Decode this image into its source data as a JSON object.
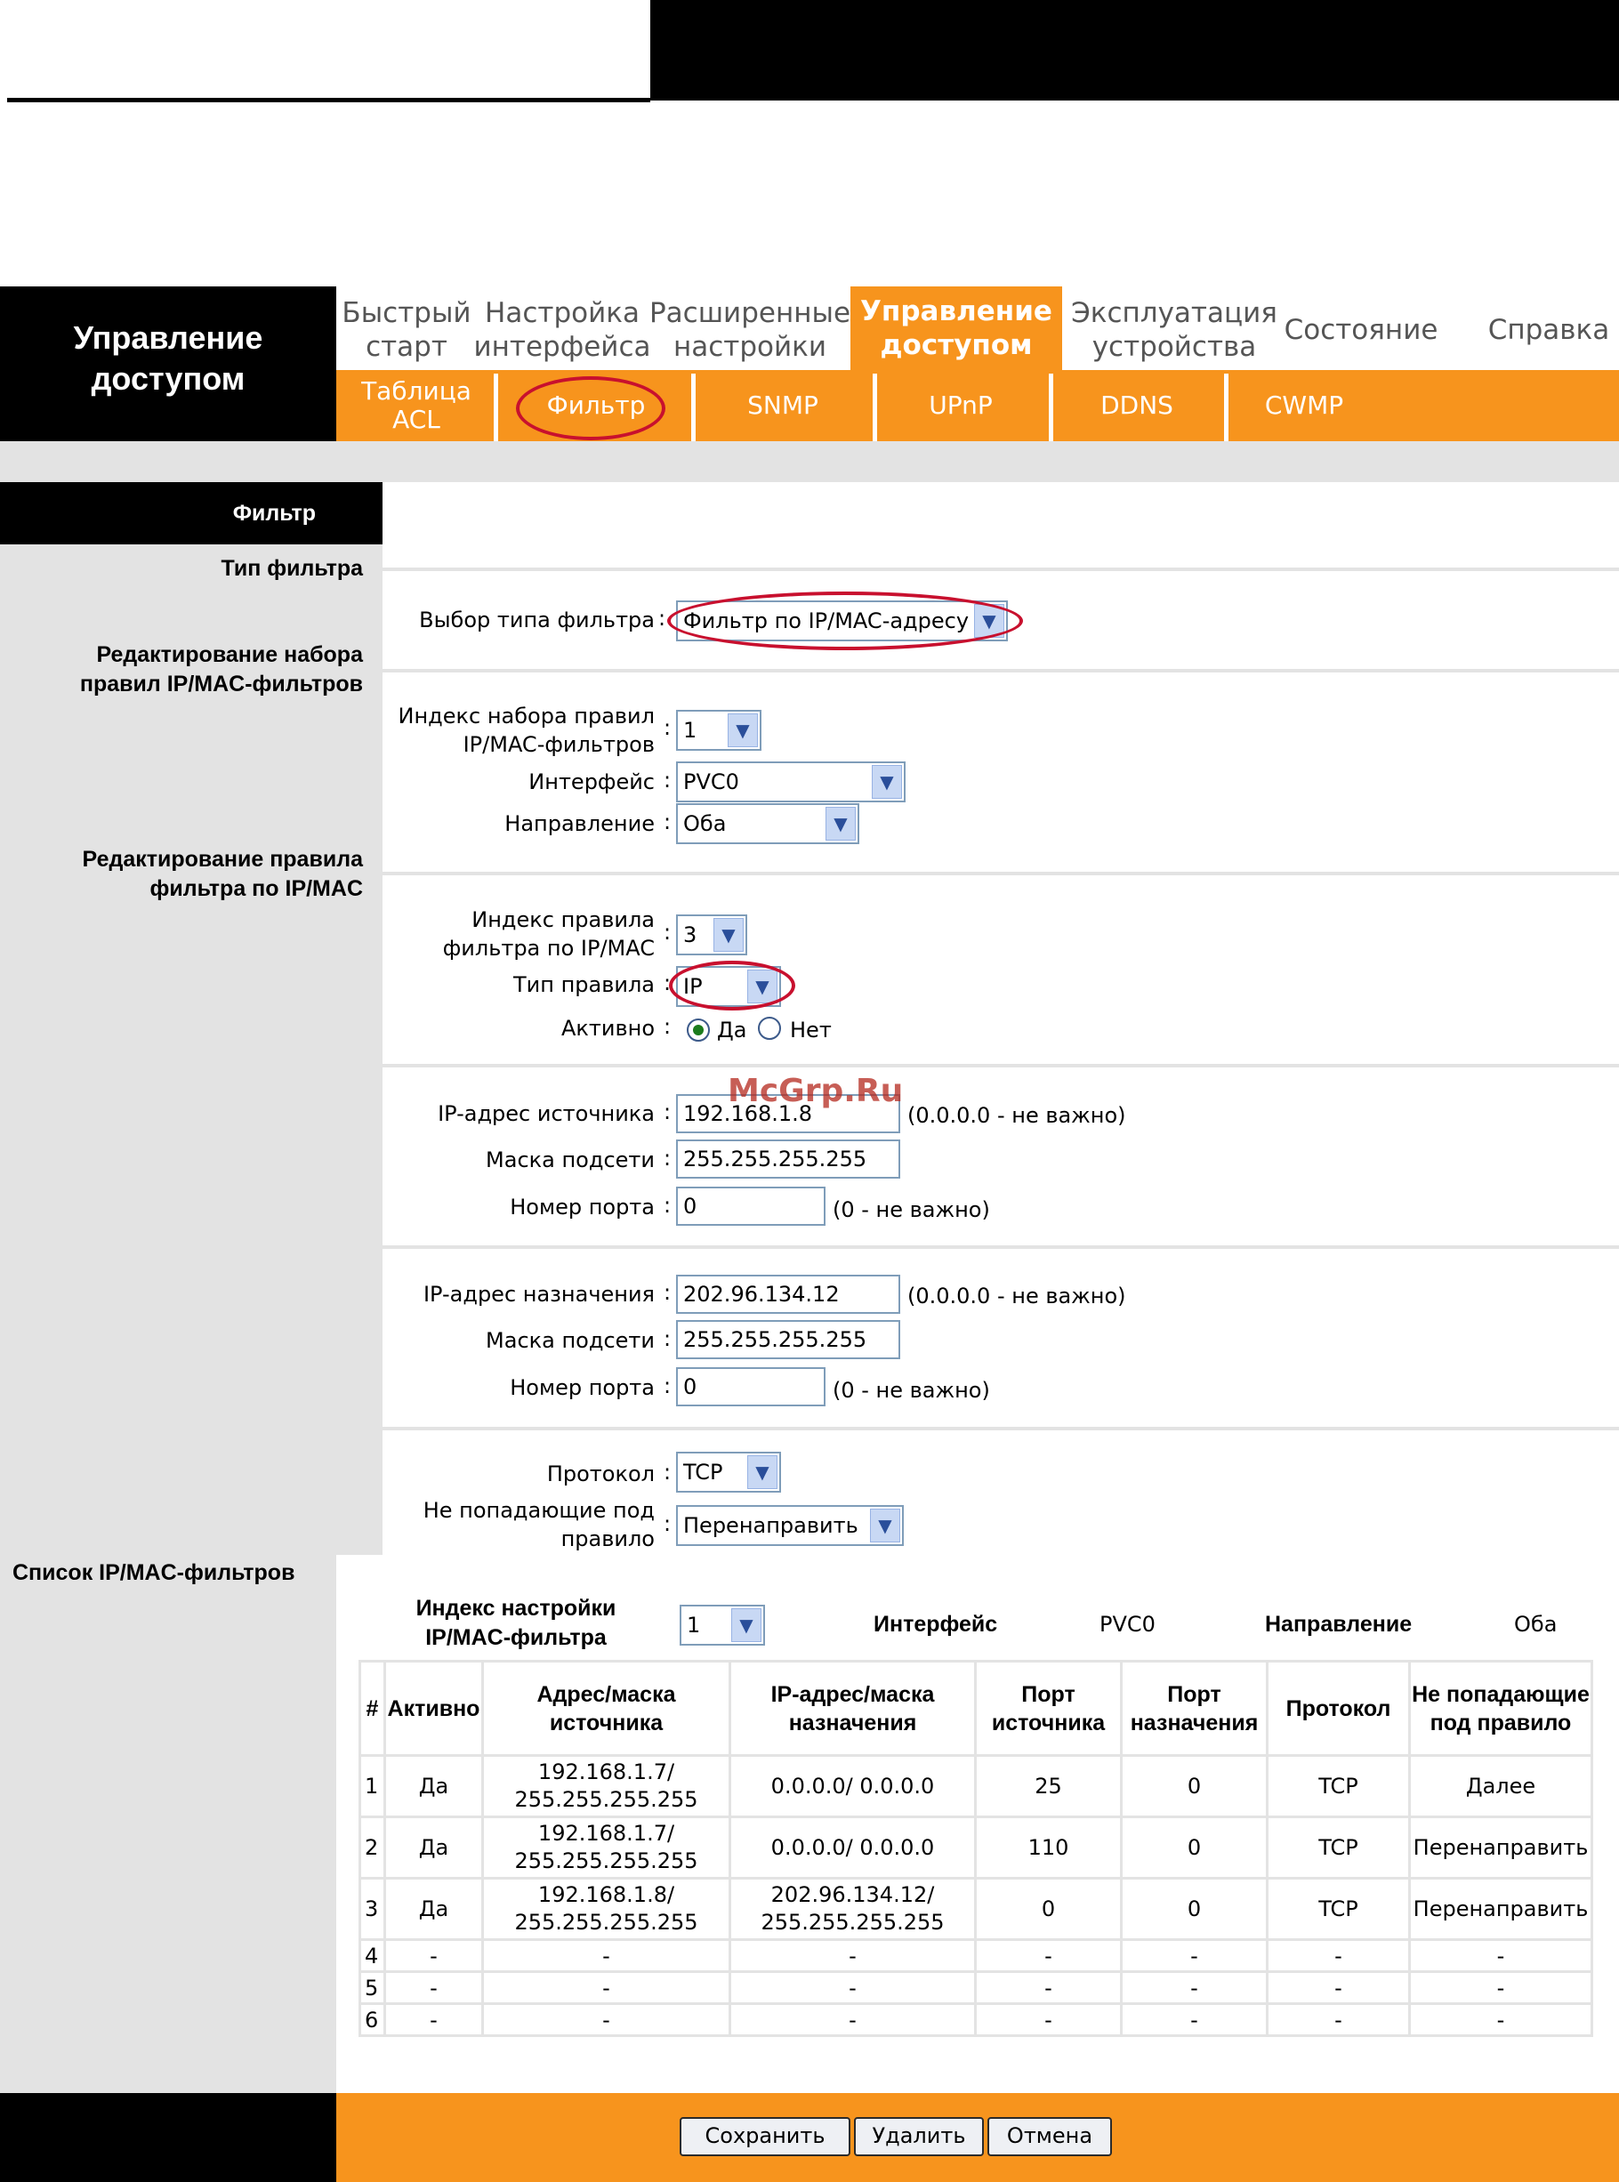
{
  "header": {
    "logo": "Управление доступом",
    "nav": [
      {
        "label": "Быстрый старт"
      },
      {
        "label": "Настройка интерфейса"
      },
      {
        "label": "Расширенные настройки"
      },
      {
        "label": "Управление доступом",
        "active": true
      },
      {
        "label": "Эксплуатация устройства"
      },
      {
        "label": "Состояние"
      },
      {
        "label": "Справка"
      }
    ],
    "subnav": [
      {
        "label": "Таблица ACL"
      },
      {
        "label": "Фильтр",
        "active": true
      },
      {
        "label": "SNMP"
      },
      {
        "label": "UPnP"
      },
      {
        "label": "DDNS"
      },
      {
        "label": "CWMP"
      }
    ]
  },
  "sidebar": {
    "title": "Фильтр",
    "filter_type": "Тип фильтра",
    "edit_set": "Редактирование набора правил IP/MAC-фильтров",
    "edit_rule": "Редактирование правила фильтра по IP/MAC",
    "list": "Список IP/MAC-фильтров"
  },
  "form": {
    "filter_type_label": "Выбор типа фильтра",
    "filter_type_value": "Фильтр по IP/MAC-адресу",
    "set_index_label": "Индекс набора правил IP/MAC-фильтров",
    "set_index_value": "1",
    "interface_label": "Интерфейс",
    "interface_value": "PVC0",
    "direction_label": "Направление",
    "direction_value": "Оба",
    "rule_index_label": "Индекс правила фильтра по IP/MAC",
    "rule_index_value": "3",
    "rule_type_label": "Тип правила",
    "rule_type_value": "IP",
    "active_label": "Активно",
    "active_yes": "Да",
    "active_no": "Нет",
    "src_ip_label": "IP-адрес источника",
    "src_ip_value": "192.168.1.8",
    "src_mask_label": "Маска подсети",
    "src_mask_value": "255.255.255.255",
    "src_port_label": "Номер порта",
    "src_port_value": "0",
    "dst_ip_label": "IP-адрес назначения",
    "dst_ip_value": "202.96.134.12",
    "dst_mask_label": "Маска подсети",
    "dst_mask_value": "255.255.255.255",
    "dst_port_label": "Номер порта",
    "dst_port_value": "0",
    "ip_hint": "(0.0.0.0 - не важно)",
    "port_hint": "(0 - не важно)",
    "protocol_label": "Протокол",
    "protocol_value": "TCP",
    "unmatched_label": "Не попадающие под правило",
    "unmatched_value": "Перенаправить",
    "colon": ":"
  },
  "list": {
    "index_label": "Индекс настройки IP/MAC-фильтра",
    "index_value": "1",
    "interface_label": "Интерфейс",
    "interface_value": "PVC0",
    "direction_label": "Направление",
    "direction_value": "Оба",
    "columns": [
      "#",
      "Активно",
      "Адрес/маска источника",
      "IP-адрес/маска назначения",
      "Порт источника",
      "Порт назначения",
      "Протокол",
      "Не попадающие под правило"
    ],
    "rows": [
      [
        "1",
        "Да",
        "192.168.1.7/ 255.255.255.255",
        "0.0.0.0/ 0.0.0.0",
        "25",
        "0",
        "TCP",
        "Далее"
      ],
      [
        "2",
        "Да",
        "192.168.1.7/ 255.255.255.255",
        "0.0.0.0/ 0.0.0.0",
        "110",
        "0",
        "TCP",
        "Перенаправить"
      ],
      [
        "3",
        "Да",
        "192.168.1.8/ 255.255.255.255",
        "202.96.134.12/ 255.255.255.255",
        "0",
        "0",
        "TCP",
        "Перенаправить"
      ],
      [
        "4",
        "-",
        "-",
        "-",
        "-",
        "-",
        "-",
        "-"
      ],
      [
        "5",
        "-",
        "-",
        "-",
        "-",
        "-",
        "-",
        "-"
      ],
      [
        "6",
        "-",
        "-",
        "-",
        "-",
        "-",
        "-",
        "-"
      ]
    ]
  },
  "footer": {
    "save": "Сохранить",
    "delete": "Удалить",
    "cancel": "Отмена"
  },
  "watermark": "McGrp.Ru",
  "colors": {
    "accent": "#f7941d",
    "highlight": "#c8102e",
    "panel": "#e3e3e3"
  }
}
